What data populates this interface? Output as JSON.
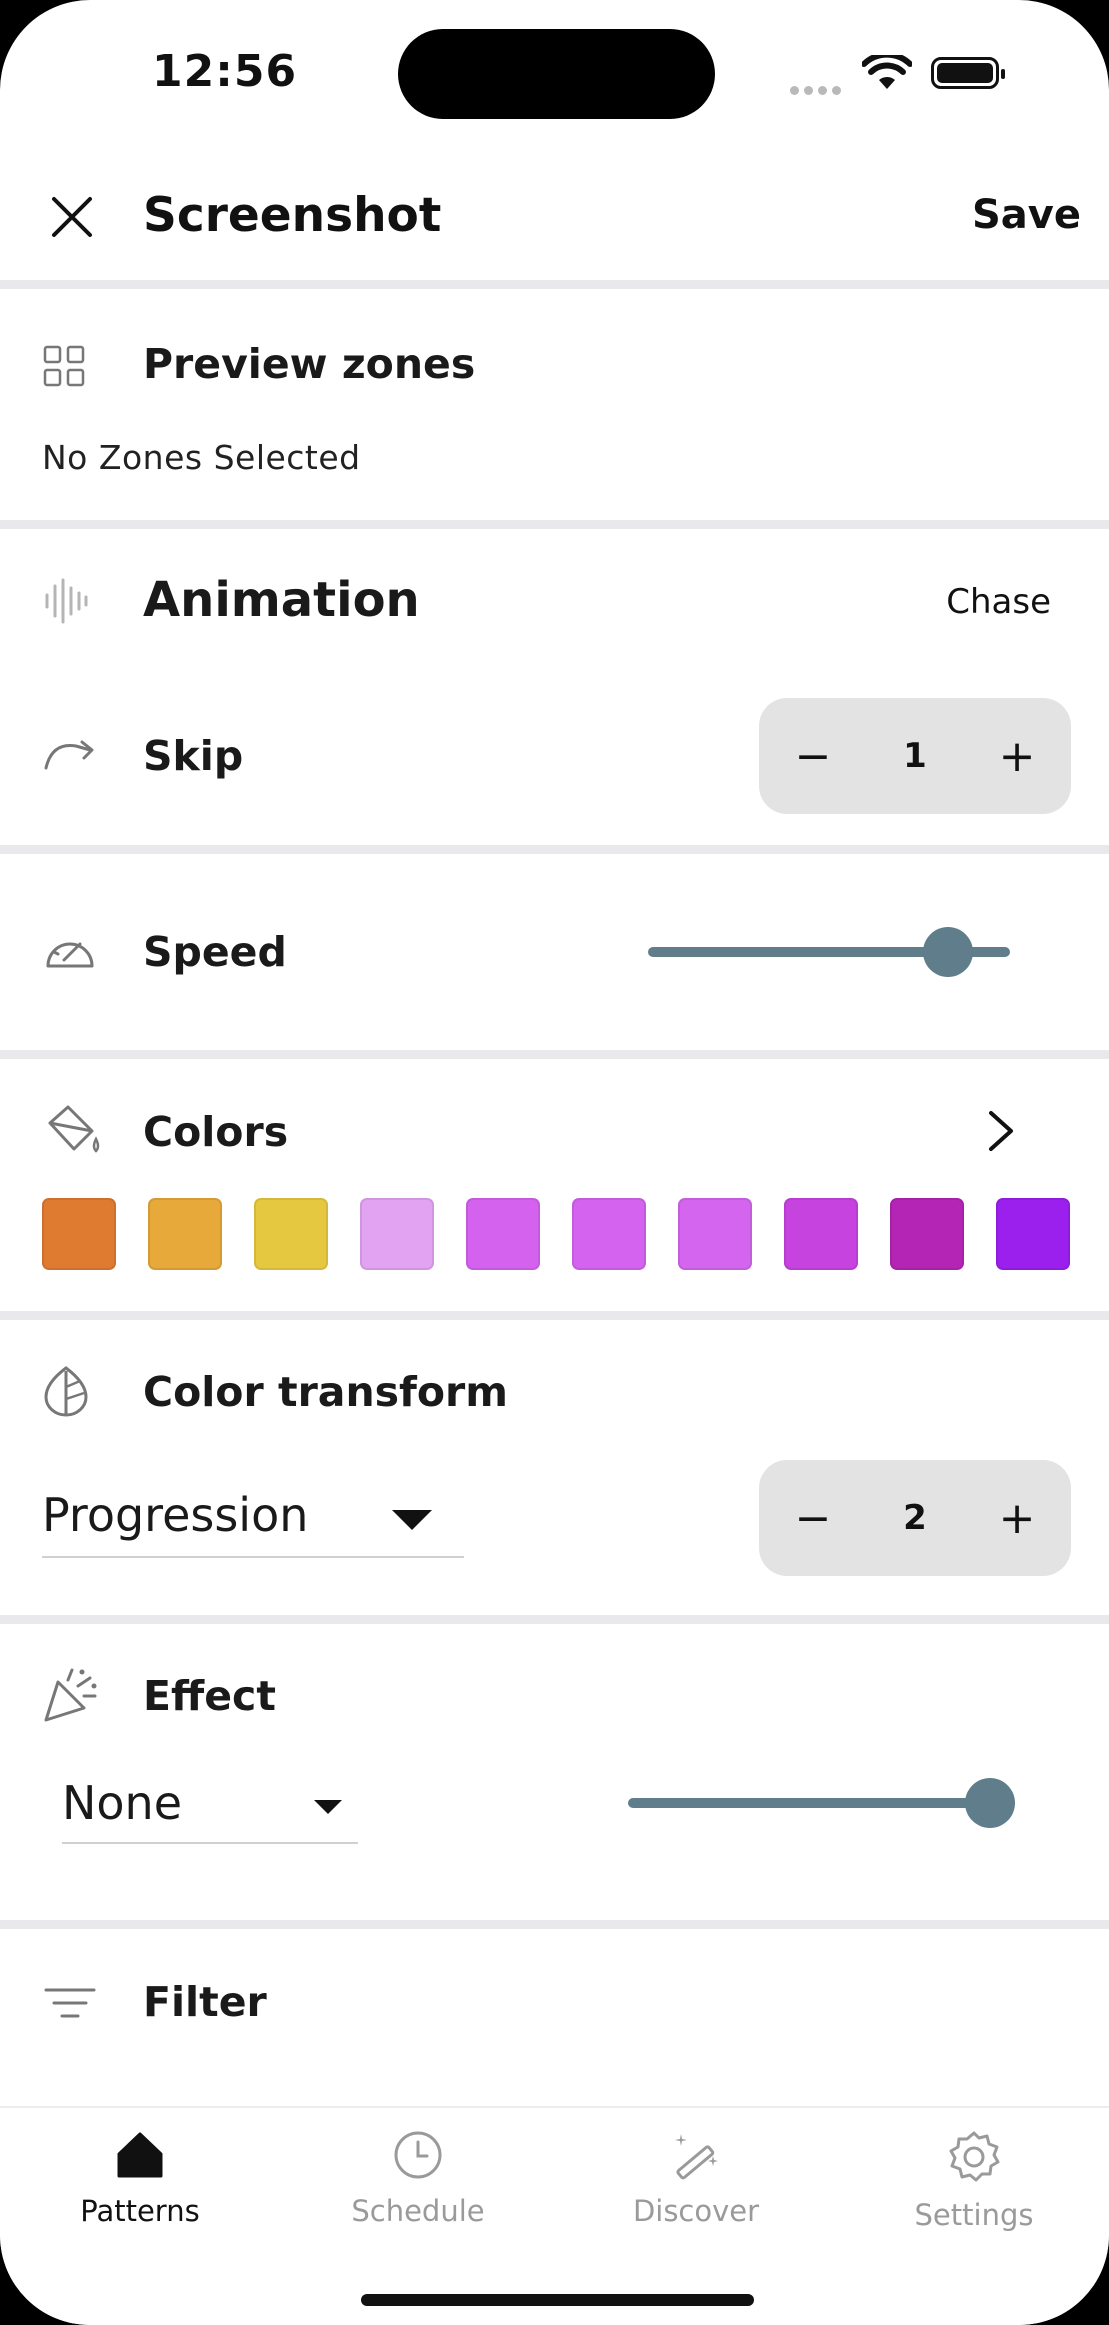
{
  "status": {
    "time": "12:56"
  },
  "header": {
    "title": "Screenshot",
    "save_label": "Save"
  },
  "preview": {
    "label": "Preview zones",
    "subtitle": "No Zones Selected"
  },
  "animation": {
    "label": "Animation",
    "value": "Chase"
  },
  "skip": {
    "label": "Skip",
    "value": "1",
    "minus": "−",
    "plus": "+"
  },
  "speed": {
    "label": "Speed",
    "level": 0.83
  },
  "colors": {
    "label": "Colors",
    "swatches": [
      "#df7a31",
      "#e6a93a",
      "#e6c840",
      "#e1a3f2",
      "#d462ef",
      "#d463f0",
      "#d465ef",
      "#c743e0",
      "#b425b6",
      "#9b20ee"
    ]
  },
  "color_transform": {
    "label": "Color transform",
    "mode": "Progression",
    "value": "2",
    "minus": "−",
    "plus": "+"
  },
  "effect": {
    "label": "Effect",
    "mode": "None",
    "level": 1.0
  },
  "filter": {
    "label": "Filter"
  },
  "tabs": [
    {
      "label": "Patterns",
      "icon": "home-icon",
      "active": true
    },
    {
      "label": "Schedule",
      "icon": "clock-icon",
      "active": false
    },
    {
      "label": "Discover",
      "icon": "magic-wand-icon",
      "active": false
    },
    {
      "label": "Settings",
      "icon": "gear-icon",
      "active": false
    }
  ],
  "theme": {
    "accent": "#607d8b",
    "separator": "#e9e9ec",
    "stepper_bg": "#e3e3e3"
  }
}
